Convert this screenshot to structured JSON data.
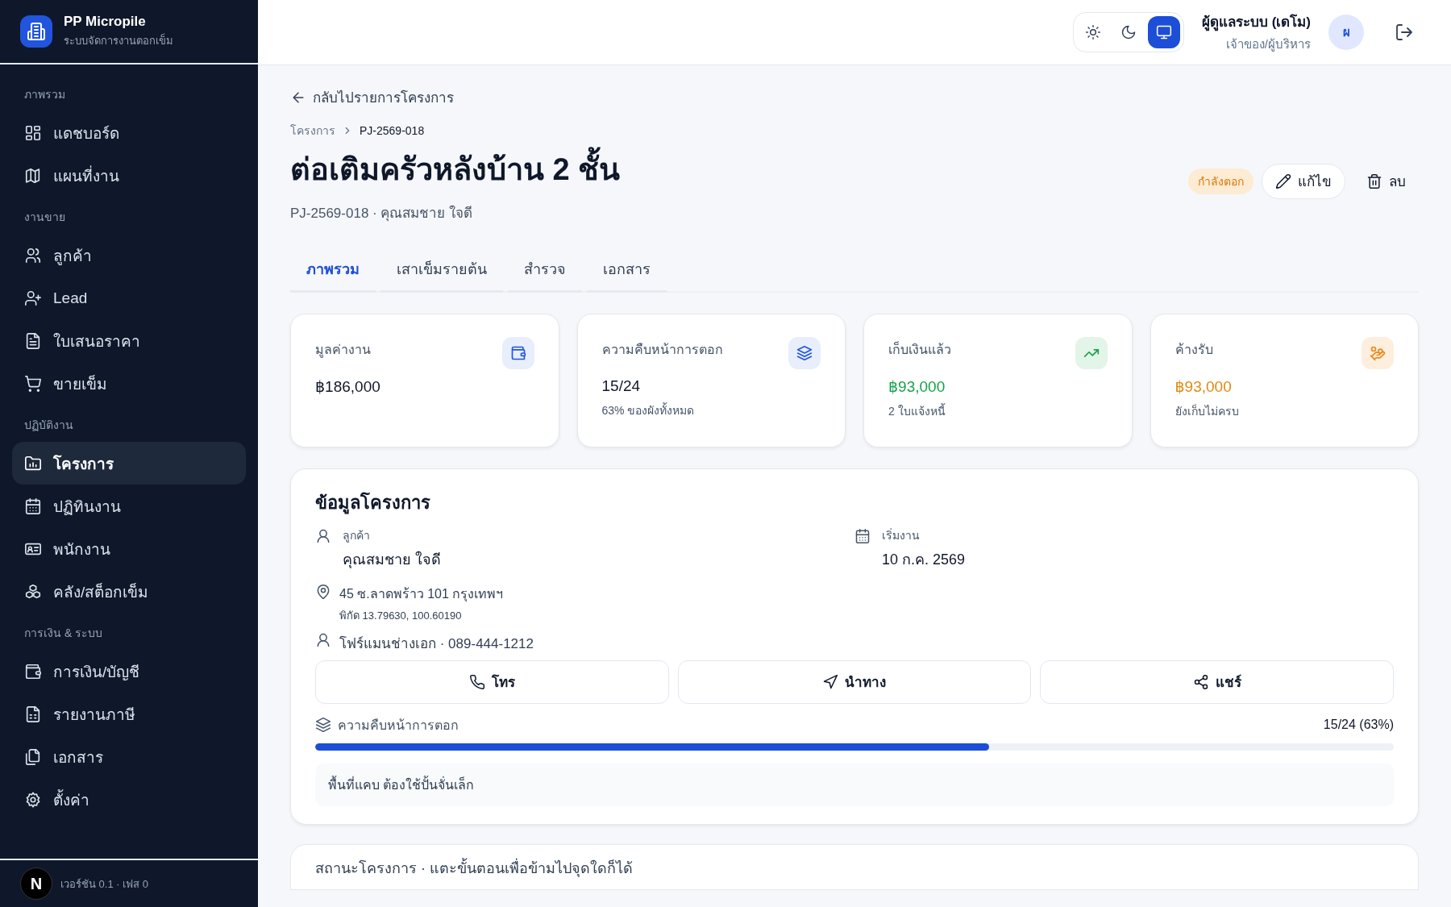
{
  "brand": {
    "name": "PP Micropile",
    "subtitle": "ระบบจัดการงานตอกเข็ม"
  },
  "nav": [
    {
      "heading": "ภาพรวม",
      "items": [
        {
          "label": "แดชบอร์ด",
          "selected": false
        },
        {
          "label": "แผนที่งาน",
          "selected": false
        }
      ]
    },
    {
      "heading": "งานขาย",
      "items": [
        {
          "label": "ลูกค้า",
          "selected": false
        },
        {
          "label": "Lead",
          "selected": false
        },
        {
          "label": "ใบเสนอราคา",
          "selected": false
        },
        {
          "label": "ขายเข็ม",
          "selected": false
        }
      ]
    },
    {
      "heading": "ปฏิบัติงาน",
      "items": [
        {
          "label": "โครงการ",
          "selected": true
        },
        {
          "label": "ปฏิทินงาน",
          "selected": false
        },
        {
          "label": "พนักงาน",
          "selected": false
        },
        {
          "label": "คลัง/สต็อกเข็ม",
          "selected": false
        }
      ]
    },
    {
      "heading": "การเงิน & ระบบ",
      "items": [
        {
          "label": "การเงิน/บัญชี",
          "selected": false
        },
        {
          "label": "รายงานภาษี",
          "selected": false
        },
        {
          "label": "เอกสาร",
          "selected": false
        },
        {
          "label": "ตั้งค่า",
          "selected": false
        }
      ]
    }
  ],
  "version": "เวอร์ชัน 0.1 · เฟส 0",
  "dev_badge": "N",
  "theme_toggle": [
    {
      "selected": false
    },
    {
      "selected": false
    },
    {
      "selected": true
    }
  ],
  "user": {
    "name": "ผู้ดูแลระบบ (เดโม)",
    "role": "เจ้าของ/ผู้บริหาร",
    "initial": "ผ"
  },
  "back_link": "กลับไปรายการโครงการ",
  "breadcrumb": [
    "โครงการ",
    "PJ-2569-018"
  ],
  "title": "ต่อเติมครัวหลังบ้าน 2 ชั้น",
  "subtitle": "PJ-2569-018 · คุณสมชาย ใจดี",
  "status_badge": "กำลังตอก",
  "actions": [
    {
      "label": "แก้ไข",
      "kind": "outline"
    },
    {
      "label": "ลบ",
      "kind": "ghost"
    }
  ],
  "tabs": [
    {
      "label": "ภาพรวม",
      "selected": true
    },
    {
      "label": "เสาเข็มรายต้น",
      "selected": false
    },
    {
      "label": "สำรวจ",
      "selected": false
    },
    {
      "label": "เอกสาร",
      "selected": false
    }
  ],
  "stats": [
    {
      "label": "มูลค่างาน",
      "value": "฿186,000",
      "kind": "neutral"
    },
    {
      "label": "ความคืบหน้าการตอก",
      "value": "15/24",
      "note": "63% ของผังทั้งหมด",
      "kind": "neutral"
    },
    {
      "label": "เก็บเงินแล้ว",
      "value": "฿93,000",
      "note": "2 ใบแจ้งหนี้",
      "kind": "success"
    },
    {
      "label": "ค้างรับ",
      "value": "฿93,000",
      "note": "ยังเก็บไม่ครบ",
      "kind": "warning"
    }
  ],
  "project_info": {
    "title": "ข้อมูลโครงการ",
    "fields": [
      {
        "label": "ลูกค้า",
        "value": "คุณสมชาย ใจดี"
      },
      {
        "label": "เริ่มงาน",
        "value": "10 ก.ค. 2569"
      }
    ],
    "address": "45 ซ.ลาดพร้าว 101 กรุงเทพฯ",
    "coordinates": "พิกัด 13.79630, 100.60190",
    "foreman": "โฟร์แมนช่างเอก · 089-444-1212",
    "buttons": [
      {
        "label": "โทร"
      },
      {
        "label": "นำทาง"
      },
      {
        "label": "แชร์"
      }
    ],
    "progress": {
      "label": "ความคืบหน้าการตอก",
      "reading": "15/24 (63%)",
      "level": 0.625
    },
    "note": "พื้นที่แคบ ต้องใช้ปั้นจั่นเล็ก"
  },
  "status_hint": "สถานะโครงการ · แตะขั้นตอนเพื่อข้ามไปจุดใดก็ได้"
}
